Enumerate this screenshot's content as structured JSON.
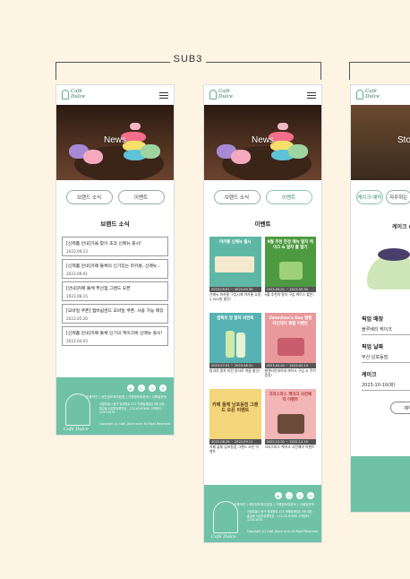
{
  "section": {
    "label": "SUB3"
  },
  "brand": {
    "logo_text": "Café Dulce",
    "logo_text_line1": "Café",
    "logo_text_line2": "Dulce"
  },
  "screen1": {
    "hero_title": "News",
    "tabs": [
      {
        "label": "브랜드 소식",
        "active": false
      },
      {
        "label": "이벤트",
        "active": false
      }
    ],
    "content_title": "브랜드 소식",
    "news": [
      {
        "title": "[신제품 안내]가을 맞이 초코 신메뉴 출시!",
        "date": "2023.09.13"
      },
      {
        "title": "[신제품 안내]카페 둘체의 인기있는 마카롱, 신메뉴...",
        "date": "2023.09.01"
      },
      {
        "title": "[안내]카페 둘체 부산점 그랜드 오픈",
        "date": "2023.08.15"
      },
      {
        "title": "[모바일 쿠폰] 멤버쉽앤드 모바일 쿠폰, 사용 가능 매장...",
        "date": "2023.05.26"
      },
      {
        "title": "[신제품 안내]카페 둘체 인기의 케이크에 신메뉴 출시!",
        "date": "2023.04.03"
      }
    ]
  },
  "screen2": {
    "hero_title": "News",
    "tabs": [
      {
        "label": "브랜드 소식",
        "active": false
      },
      {
        "label": "이벤트",
        "active": true
      }
    ],
    "content_title": "이벤트",
    "events": [
      {
        "img_title": "마카롱 신메뉴 출시",
        "bg": "#5fb8a6",
        "date": "2023.09.01 ~ 2023.09.30",
        "desc": "신메뉴 마카롱 구입시에 마카롱 쇼핑 2,000원 할인!"
      },
      {
        "img_title": "9월 추천 한정 메뉴 말차 케이크 & 말차 롤 딸기",
        "bg": "#4e9a40",
        "date": "2023.09.01 ~ 2023.09.30",
        "desc": "9월 추천의 말차 구입 케이스 할인!"
      },
      {
        "img_title": "컴팩트 빙 말차 비전복",
        "bg": "#57b3b3",
        "date": "2023.07.01 ~ 2023.08.31",
        "desc": "빙과의 말차 비전 말차로 여름 할인!"
      },
      {
        "img_title": "Valentine's Day 발렌타인데이 특별 이벤트",
        "bg": "#e9999c",
        "date": "2023.02.01 ~ 2023.02.14",
        "desc": "발렌타인데이에 케이크 구입 시 쿠키 증정!"
      },
      {
        "img_title": "카페 둘체 남포동점 그랜드 오픈 이벤트",
        "bg": "#f3d57a",
        "date": "2022.08.26 ~ 2022.09.11",
        "desc": "카페 둘체 남포동점 그랜드 오픈 이벤트"
      },
      {
        "img_title": "크리스마스 케이크 사전예약 이벤트",
        "bg": "#f2b6b6",
        "date": "2022.12.01 ~ 2022.12.19",
        "desc": "크리스마스 케이크 사전예약 이벤트"
      }
    ]
  },
  "screen3": {
    "hero_title": "Sto",
    "tabs": [
      {
        "label": "케이크 예약",
        "active": true
      },
      {
        "label": "자주하는",
        "active": false
      }
    ],
    "cake_title": "케이크 C",
    "fields": [
      {
        "label": "픽업 매장",
        "value": "블루베리 케이크"
      },
      {
        "label": "픽업 날짜",
        "value": "부산 남포동점"
      },
      {
        "label": "케이크",
        "value": "2023-10-10(화)"
      }
    ],
    "button": "예약"
  },
  "footer": {
    "social_icons": [
      "youtube-icon",
      "instagram-icon",
      "twitter-icon",
      "mail-icon"
    ],
    "links": "이용약관  |  개인정보처리방침  |  가맹점모집문의  |  이메일문의",
    "info": "서울특별시 중구 청계천로 123 카페둘체빌딩 5층  대표 : 홍길동  사업자등록번호 : 123-45-67890  고객센터 : 1234-5678",
    "copyright": "Copyright (c) Café_Dulce.co.kr All Right Reserved"
  },
  "colors": {
    "mint": "#6fc2a6",
    "accent_green": "#2f8a64",
    "background": "#fdf4e3"
  }
}
